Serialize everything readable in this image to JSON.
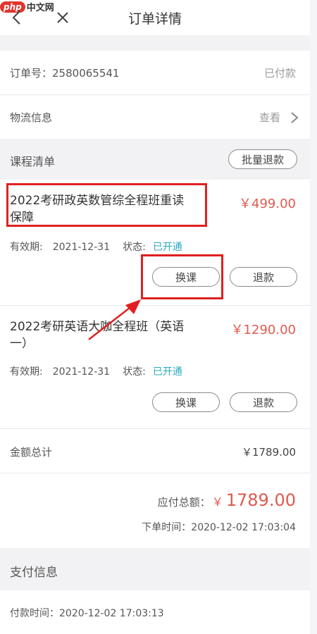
{
  "header": {
    "title": "订单详情",
    "watermark_brand": "php",
    "watermark_site": "中文网"
  },
  "order": {
    "number_label": "订单号：",
    "number": "2580065541",
    "status": "已付款"
  },
  "logistics": {
    "label": "物流信息",
    "action": "查看"
  },
  "course_list": {
    "title": "课程清单",
    "batch_refund_label": "批量退款",
    "items": [
      {
        "name_line1": "2022考研政英数管综全程班重读",
        "name_line2": "保障",
        "price": "￥499.00",
        "validity_label": "有效期:",
        "validity_date": "2021-12-31",
        "status_label": "状态:",
        "status_value": "已开通",
        "exchange_label": "换课",
        "refund_label": "退款"
      },
      {
        "name_line1": "2022考研英语大咖全程班（英语",
        "name_line2": "一）",
        "price": "￥1290.00",
        "validity_label": "有效期:",
        "validity_date": "2021-12-31",
        "status_label": "状态:",
        "status_value": "已开通",
        "exchange_label": "换课",
        "refund_label": "退款"
      }
    ]
  },
  "totals": {
    "subtotal_label": "金额总计",
    "subtotal_value": "￥1789.00",
    "payable_label": "应付总额：",
    "payable_currency": "￥",
    "payable_value": "1789.00",
    "order_time_label": "下单时间：",
    "order_time": "2020-12-02 17:03:04"
  },
  "payment": {
    "title": "支付信息",
    "pay_time_label": "付款时间：",
    "pay_time": "2020-12-02 17:03:13"
  },
  "colors": {
    "price_red": "#e05a4f",
    "status_teal": "#2aa8c2",
    "highlight_red": "#e02020"
  }
}
